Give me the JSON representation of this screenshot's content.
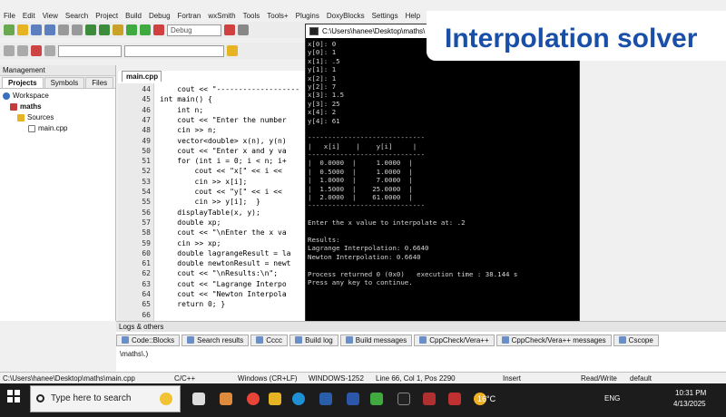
{
  "menu": [
    "File",
    "Edit",
    "View",
    "Search",
    "Project",
    "Build",
    "Debug",
    "Fortran",
    "wxSmith",
    "Tools",
    "Tools+",
    "Plugins",
    "DoxyBlocks",
    "Settings",
    "Help"
  ],
  "toolbar": {
    "build_target": "Debug"
  },
  "management": {
    "title": "Management",
    "tabs": [
      "Projects",
      "Symbols",
      "Files"
    ],
    "tree": [
      {
        "label": "Workspace",
        "icon": "workspace-icon"
      },
      {
        "label": "maths",
        "icon": "project-icon"
      },
      {
        "label": "Sources",
        "icon": "folder-icon"
      },
      {
        "label": "main.cpp",
        "icon": "file-icon"
      }
    ]
  },
  "editor": {
    "tab": "main.cpp",
    "line_numbers": [
      "44",
      "45",
      "46",
      "47",
      "48",
      "49",
      "50",
      "51",
      "52",
      "53",
      "54",
      "55",
      "56",
      "57",
      "58",
      "59",
      "60",
      "61",
      "62",
      "63",
      "64",
      "65",
      "66"
    ],
    "lines": [
      "    cout << \"-------------------",
      "int main() {",
      "    int n;",
      "    cout << \"Enter the number",
      "    cin >> n;",
      "    vector<double> x(n), y(n)",
      "    cout << \"Enter x and y va",
      "    for (int i = 0; i < n; i+",
      "        cout << \"x[\" << i <<",
      "        cin >> x[i];",
      "        cout << \"y[\" << i <<",
      "        cin >> y[i];  }",
      "    displayTable(x, y);",
      "    double xp;",
      "    cout << \"\\nEnter the x va",
      "    cin >> xp;",
      "    double lagrangeResult = la",
      "    double newtonResult = newt",
      "    cout << \"\\nResults:\\n\";",
      "    cout << \"Lagrange Interpo",
      "    cout << \"Newton Interpola",
      "    return 0; }",
      ""
    ]
  },
  "console": {
    "title": "C:\\Users\\hanee\\Desktop\\maths\\",
    "lines": [
      "x[0]: 0",
      "y[0]: 1",
      "x[1]: .5",
      "y[1]: 1",
      "x[2]: 1",
      "y[2]: 7",
      "x[3]: 1.5",
      "y[3]: 25",
      "x[4]: 2",
      "y[4]: 61",
      "",
      "-----------------------------",
      "|   x[i]    |    y[i]     |",
      "-----------------------------",
      "|  0.0000  |     1.0000  |",
      "|  0.5000  |     1.0000  |",
      "|  1.0000  |     7.0000  |",
      "|  1.5000  |    25.0000  |",
      "|  2.0000  |    61.0000  |",
      "-----------------------------",
      "",
      "Enter the x value to interpolate at: .2",
      "",
      "Results:",
      "Lagrange Interpolation: 0.6640",
      "Newton Interpolation: 0.6640",
      "",
      "Process returned 0 (0x0)   execution time : 38.144 s",
      "Press any key to continue."
    ]
  },
  "banner": {
    "text": "Interpolation solver"
  },
  "logs": {
    "title": "Logs & others",
    "tabs": [
      "Code::Blocks",
      "Search results",
      "Cccc",
      "Build log",
      "Build messages",
      "CppCheck/Vera++",
      "CppCheck/Vera++ messages",
      "Cscope"
    ],
    "path": "\\maths\\.)"
  },
  "status": {
    "file": "C:\\Users\\hanee\\Desktop\\maths\\main.cpp",
    "lang": "C/C++",
    "eol": "Windows (CR+LF)",
    "encoding": "WINDOWS-1252",
    "position": "Line 66, Col 1, Pos 2290",
    "mode": "Insert",
    "access": "Read/Write",
    "profile": "default"
  },
  "taskbar": {
    "search_placeholder": "Type here to search",
    "weather": "16°C",
    "lang": "ENG",
    "time": "10:31 PM",
    "date": "4/13/2025"
  }
}
